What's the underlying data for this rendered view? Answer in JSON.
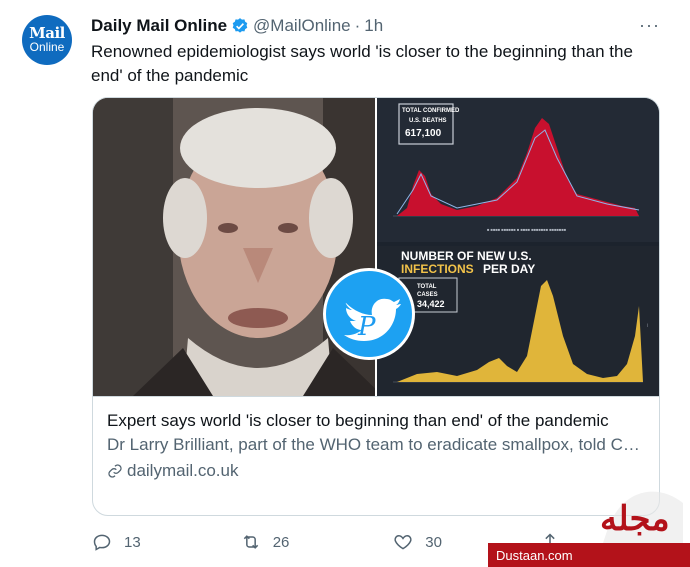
{
  "tweet": {
    "avatar": {
      "line1": "Mail",
      "line2": "Online"
    },
    "author_name": "Daily Mail Online",
    "handle": "@MailOnline",
    "separator": "·",
    "time": "1h",
    "more_icon": "more-horizontal-icon",
    "text": "Renowned epidemiologist says world 'is closer to the beginning than the end' of the pandemic"
  },
  "card": {
    "chart_top": {
      "line1": "TOTAL CONFIRMED",
      "line2": "U.S. DEATHS",
      "value": "617,100"
    },
    "chart_bottom": {
      "title_line1": "NUMBER OF NEW U.S.",
      "title_line2_a": "INFECTIONS",
      "title_line2_b": "PER DAY",
      "box_line1": "TOTAL",
      "box_line2": "CASES",
      "box_value": "34,422"
    },
    "title": "Expert says world 'is closer to beginning than end' of the pandemic",
    "description": "Dr Larry Brilliant, part of the WHO team to eradicate smallpox, told CNBC's Street Signs that the pandemic is not close to over because onl…",
    "domain": "dailymail.co.uk"
  },
  "actions": {
    "reply_count": "13",
    "retweet_count": "26",
    "like_count": "30"
  },
  "watermark": {
    "site": "Dustaan.com"
  },
  "colors": {
    "brand_blue": "#1d9bf0",
    "avatar_blue": "#0f6bbf",
    "muted": "#536471",
    "deaths_red": "#c8102e",
    "cases_yellow": "#e0b53a"
  }
}
